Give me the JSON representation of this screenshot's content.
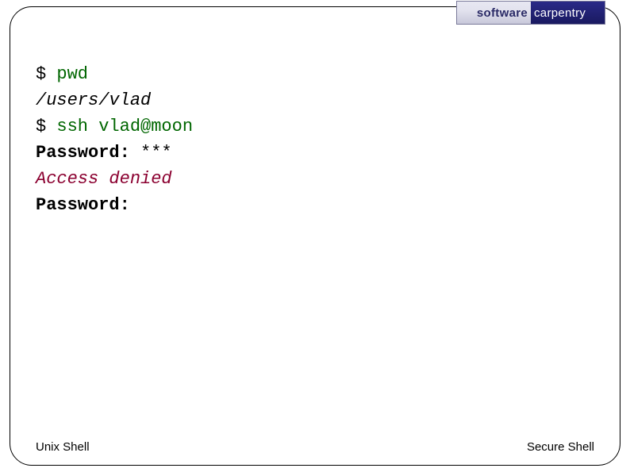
{
  "logo": {
    "left": "software",
    "right": "carpentry"
  },
  "terminal": {
    "line1": {
      "prompt": "$ ",
      "cmd": "pwd"
    },
    "line2": {
      "output": "/users/vlad"
    },
    "line3": {
      "prompt": "$ ",
      "cmd": "ssh vlad@moon"
    },
    "line4": {
      "label": "Password: ",
      "masked": "***"
    },
    "line5": {
      "error": "Access denied"
    },
    "line6": {
      "label": "Password:"
    }
  },
  "footer": {
    "left": "Unix Shell",
    "right": "Secure Shell"
  }
}
